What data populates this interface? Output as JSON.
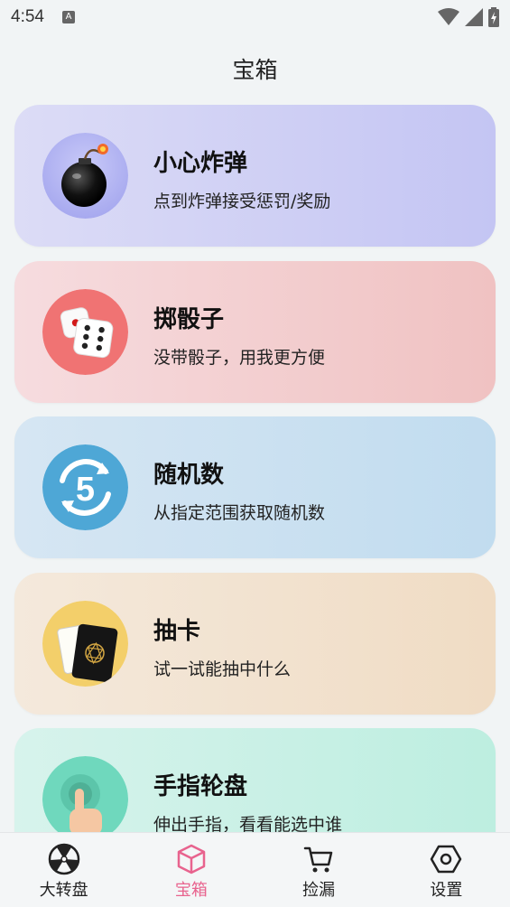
{
  "status_bar": {
    "time": "4:54",
    "notification_icon": "a-icon",
    "right_icons": [
      "wifi-icon",
      "signal-icon",
      "battery-charging-icon"
    ]
  },
  "page": {
    "title": "宝箱"
  },
  "cards": [
    {
      "title": "小心炸弹",
      "subtitle": "点到炸弹接受惩罚/奖励",
      "icon": "bomb-icon"
    },
    {
      "title": "掷骰子",
      "subtitle": "没带骰子，用我更方便",
      "icon": "dice-icon"
    },
    {
      "title": "随机数",
      "subtitle": "从指定范围获取随机数",
      "icon": "random-number-icon"
    },
    {
      "title": "抽卡",
      "subtitle": "试一试能抽中什么",
      "icon": "card-draw-icon"
    },
    {
      "title": "手指轮盘",
      "subtitle": "伸出手指，看看能选中谁",
      "icon": "finger-tap-icon"
    }
  ],
  "bottom_nav": [
    {
      "label": "大转盘",
      "icon": "wheel-icon",
      "active": false
    },
    {
      "label": "宝箱",
      "icon": "box-icon",
      "active": true
    },
    {
      "label": "捡漏",
      "icon": "cart-icon",
      "active": false
    },
    {
      "label": "设置",
      "icon": "hexagon-settings-icon",
      "active": false
    }
  ],
  "colors": {
    "active_tab": "#e8638e",
    "background": "#f1f4f5"
  }
}
